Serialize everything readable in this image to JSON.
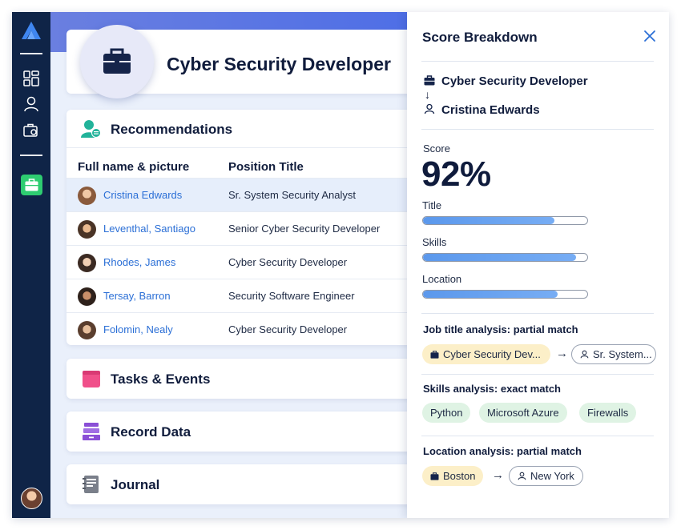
{
  "header": {
    "title": "Cyber Security Developer"
  },
  "recommendations": {
    "title": "Recommendations",
    "columns": [
      "Full name & picture",
      "Position Title"
    ],
    "rows": [
      {
        "name": "Cristina Edwards",
        "position": "Sr. System Security Analyst",
        "selected": true
      },
      {
        "name": "Leventhal, Santiago",
        "position": "Senior Cyber Security Developer",
        "selected": false
      },
      {
        "name": "Rhodes, James",
        "position": "Cyber Security Developer",
        "selected": false
      },
      {
        "name": "Tersay, Barron",
        "position": "Security Software Engineer",
        "selected": false
      },
      {
        "name": "Folomin, Nealy",
        "position": "Cyber Security Developer",
        "selected": false
      }
    ]
  },
  "sections": [
    {
      "label": "Tasks & Events",
      "icon": "calendar-icon",
      "color": "#f0508a"
    },
    {
      "label": "Record Data",
      "icon": "stack-icon",
      "color": "#8a4fd6"
    },
    {
      "label": "Journal",
      "icon": "journal-icon",
      "color": "#7a7f8a"
    }
  ],
  "panel": {
    "title": "Score Breakdown",
    "job": "Cyber Security Developer",
    "arrow": "↓",
    "candidate": "Cristina Edwards",
    "score_label": "Score",
    "score_value": "92%",
    "bars": [
      {
        "label": "Title",
        "value": 0.8
      },
      {
        "label": "Skills",
        "value": 0.93
      },
      {
        "label": "Location",
        "value": 0.82
      }
    ],
    "job_title_analysis": {
      "title": "Job title analysis: partial match",
      "from": "Cyber Security Dev...",
      "to": "Sr. System..."
    },
    "skills_analysis": {
      "title": "Skills analysis: exact match",
      "skills": [
        "Python",
        "Microsoft Azure",
        "Firewalls"
      ]
    },
    "location_analysis": {
      "title": "Location analysis: partial match",
      "from": "Boston",
      "to": "New York"
    },
    "chip_arrow": "→"
  },
  "colors": {
    "accent": "#2b6fd6",
    "sidebar": "#0f2447",
    "active": "#2ecc71",
    "bar": "#5b98ec"
  }
}
